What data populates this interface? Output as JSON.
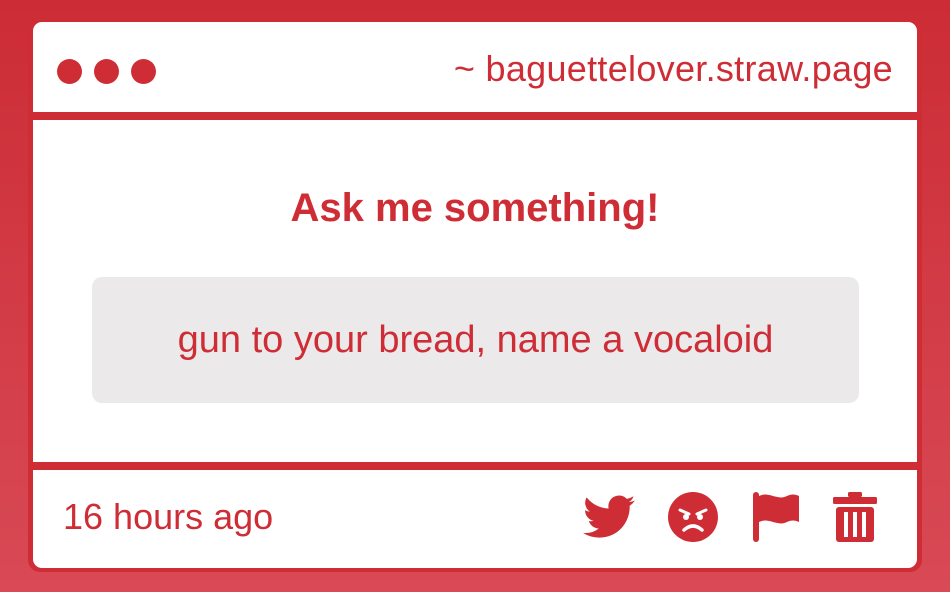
{
  "window": {
    "url": "~ baguettelover.straw.page"
  },
  "main": {
    "heading": "Ask me something!",
    "question": "gun to your bread, name a vocaloid"
  },
  "footer": {
    "timestamp": "16 hours ago",
    "actions": [
      {
        "name": "twitter-share",
        "icon": "twitter-bird-icon"
      },
      {
        "name": "react",
        "icon": "angry-face-icon"
      },
      {
        "name": "report",
        "icon": "flag-icon"
      },
      {
        "name": "delete",
        "icon": "trash-icon"
      }
    ]
  },
  "colors": {
    "accent": "#cf2d36",
    "background": "#ffffff",
    "question_box": "#ebe9ea"
  }
}
